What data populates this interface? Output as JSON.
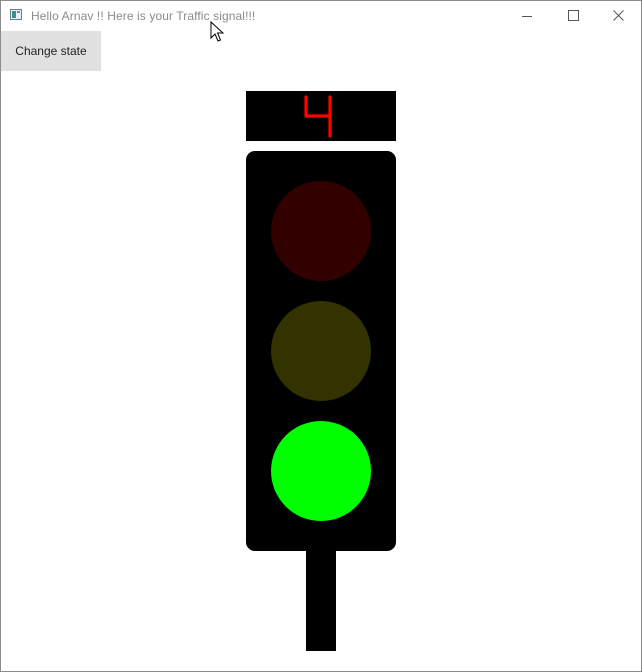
{
  "window": {
    "title": "Hello Arnav !! Here is your Traffic signal!!!",
    "controls": {
      "minimize_icon": "minimize-icon",
      "maximize_icon": "maximize-icon",
      "close_icon": "close-icon"
    }
  },
  "toolbar": {
    "change_state_label": "Change state"
  },
  "counter": {
    "value": "4",
    "color": "#ff0000"
  },
  "signal": {
    "active": "green",
    "lamps": [
      {
        "name": "red",
        "color": "#330000",
        "on": false
      },
      {
        "name": "yellow",
        "color": "#333300",
        "on": false
      },
      {
        "name": "green",
        "color": "#00ff00",
        "on": true
      }
    ]
  }
}
